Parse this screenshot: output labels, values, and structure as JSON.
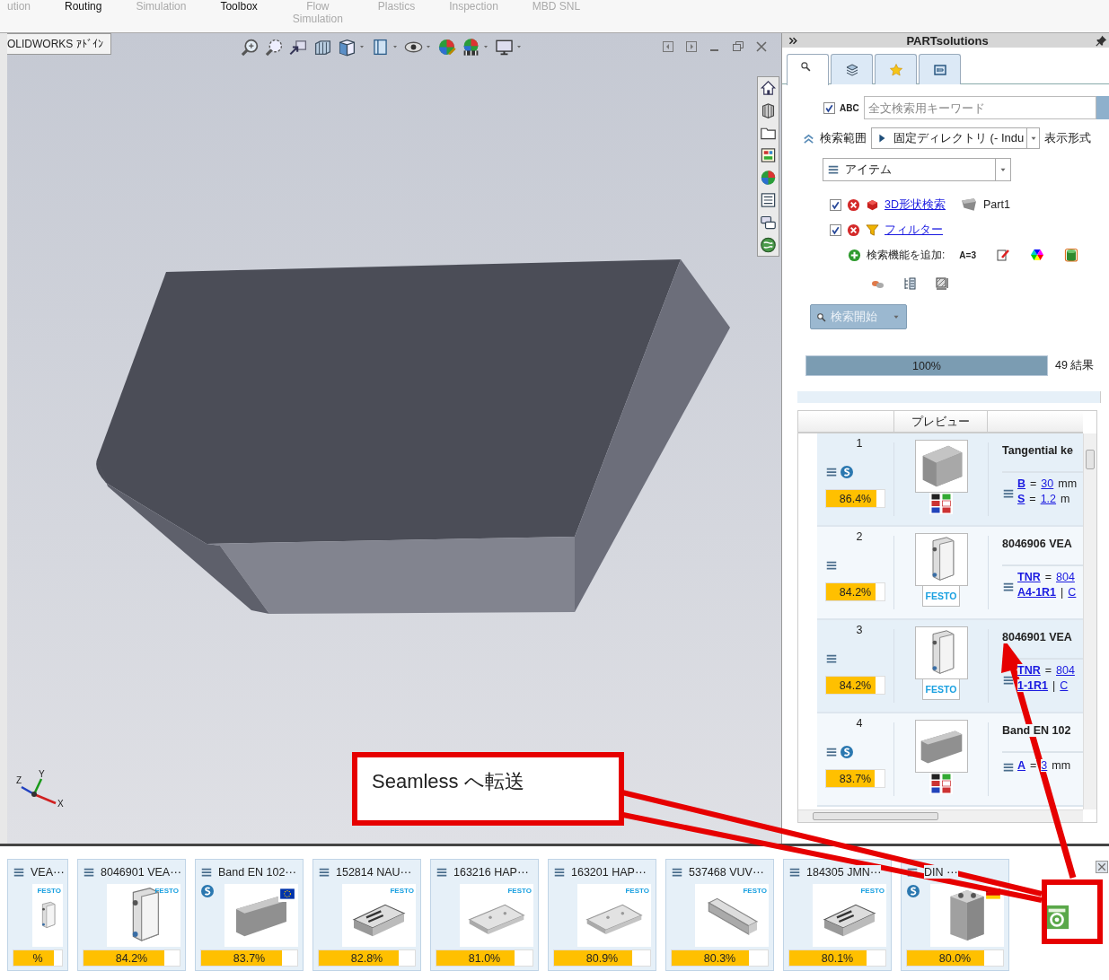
{
  "ribbon": {
    "tabs": [
      {
        "label": "ution",
        "disabled": true
      },
      {
        "label": "Routing",
        "disabled": false
      },
      {
        "label": "Simulation",
        "disabled": true
      },
      {
        "label": "Toolbox",
        "disabled": false
      },
      {
        "label": "Flow Simulation",
        "disabled": true
      },
      {
        "label": "Plastics",
        "disabled": true
      },
      {
        "label": "Inspection",
        "disabled": true
      },
      {
        "label": "MBD SNL",
        "disabled": true
      }
    ]
  },
  "viewport": {
    "tab": "OLIDWORKS ｱﾄﾞｲﾝ",
    "axes": {
      "x": "X",
      "y": "Y",
      "z": "Z"
    }
  },
  "panel": {
    "title": "PARTsolutions",
    "tabs": [
      {
        "kind": "search",
        "selected": true
      },
      {
        "kind": "catalog",
        "selected": false
      },
      {
        "kind": "favorites",
        "selected": false
      },
      {
        "kind": "window",
        "selected": false
      }
    ],
    "fulltext": {
      "checked": true,
      "label": "ABC",
      "placeholder": "全文検索用キーワード"
    },
    "scope": {
      "label": "検索範囲",
      "value": "固定ディレクトリ (- Indu",
      "view_label": "表示形式"
    },
    "view_mode": {
      "value": "アイテム"
    },
    "criteria": [
      {
        "kind": "shape",
        "checked": true,
        "link": "3D形状検索",
        "target": "Part1"
      },
      {
        "kind": "filter",
        "checked": true,
        "link": "フィルター"
      }
    ],
    "add_function": {
      "label": "検索機能を追加:",
      "formula": "A=3"
    },
    "search_button": {
      "label": "検索開始",
      "disabled": true
    },
    "progress": {
      "level": 1,
      "reading": "100%",
      "count": "49 結果"
    },
    "results": {
      "header": "プレビュー",
      "rows": [
        {
          "number": "1",
          "score": "86.4%",
          "level": 0.864,
          "badge": true,
          "kind": "block",
          "brand": {
            "kind": "flags"
          },
          "title": "Tangential ke",
          "props": [
            [
              {
                "t": "B",
                "link": true
              },
              {
                "t": "=",
                "link": false
              },
              {
                "t": "30",
                "link": true
              },
              {
                "t": "mm",
                "link": false
              }
            ],
            [
              {
                "t": "S",
                "link": true
              },
              {
                "t": "=",
                "link": false
              },
              {
                "t": "1.2",
                "link": true
              },
              {
                "t": "m",
                "link": false
              }
            ]
          ]
        },
        {
          "number": "2",
          "score": "84.2%",
          "level": 0.842,
          "badge": false,
          "kind": "valve",
          "brand": {
            "kind": "logo",
            "text": "FESTO"
          },
          "title": "8046906 VEA",
          "props": [
            [
              {
                "t": "TNR",
                "link": true
              },
              {
                "t": "=",
                "link": false
              },
              {
                "t": "804",
                "link": true
              }
            ],
            [
              {
                "t": "A4-1R1",
                "link": true
              },
              {
                "t": "|",
                "link": false
              },
              {
                "t": "C",
                "link": true
              }
            ]
          ]
        },
        {
          "number": "3",
          "score": "84.2%",
          "level": 0.842,
          "badge": false,
          "kind": "valve",
          "brand": {
            "kind": "logo",
            "text": "FESTO"
          },
          "title": "8046901 VEA",
          "props": [
            [
              {
                "t": "TNR",
                "link": true
              },
              {
                "t": "=",
                "link": false
              },
              {
                "t": "804",
                "link": true
              }
            ],
            [
              {
                "t": "1-1R1",
                "link": true
              },
              {
                "t": "|",
                "link": false
              },
              {
                "t": "C",
                "link": true
              }
            ]
          ]
        },
        {
          "number": "4",
          "score": "83.7%",
          "level": 0.837,
          "badge": true,
          "kind": "slab",
          "brand": {
            "kind": "flags"
          },
          "title": "Band EN 102",
          "props": [
            [
              {
                "t": "A",
                "link": true
              },
              {
                "t": "=",
                "link": false
              },
              {
                "t": "3",
                "link": true
              },
              {
                "t": "mm",
                "link": false
              }
            ]
          ]
        }
      ]
    }
  },
  "tray": {
    "cards": [
      {
        "title": "VEA⋯",
        "score": "%",
        "level": 0.842,
        "badge": false,
        "kind": "valve",
        "brand": {
          "kind": "logo",
          "text": "FESTO"
        }
      },
      {
        "title": "8046901 VEA⋯",
        "score": "84.2%",
        "level": 0.842,
        "badge": false,
        "kind": "valve",
        "brand": {
          "kind": "logo",
          "text": "FESTO"
        }
      },
      {
        "title": "Band EN 102⋯",
        "score": "83.7%",
        "level": 0.837,
        "badge": true,
        "kind": "slab",
        "brand": {
          "kind": "eu"
        }
      },
      {
        "title": "152814 NAU⋯",
        "score": "82.8%",
        "level": 0.828,
        "badge": false,
        "kind": "manifold",
        "brand": {
          "kind": "logo",
          "text": "FESTO"
        }
      },
      {
        "title": "163216 HAP⋯",
        "score": "81.0%",
        "level": 0.81,
        "badge": false,
        "kind": "rail",
        "brand": {
          "kind": "logo",
          "text": "FESTO"
        }
      },
      {
        "title": "163201 HAP⋯",
        "score": "80.9%",
        "level": 0.809,
        "badge": false,
        "kind": "rail",
        "brand": {
          "kind": "logo",
          "text": "FESTO"
        }
      },
      {
        "title": "537468 VUV⋯",
        "score": "80.3%",
        "level": 0.803,
        "badge": false,
        "kind": "bar",
        "brand": {
          "kind": "logo",
          "text": "FESTO"
        }
      },
      {
        "title": "184305 JMN⋯",
        "score": "80.1%",
        "level": 0.801,
        "badge": false,
        "kind": "manifold",
        "brand": {
          "kind": "logo",
          "text": "FESTO"
        }
      },
      {
        "title": "DIN ⋯",
        "score": "80.0%",
        "level": 0.8,
        "badge": true,
        "kind": "cube",
        "brand": {
          "kind": "de"
        }
      }
    ]
  },
  "callout": {
    "text": "Seamless へ転送"
  }
}
